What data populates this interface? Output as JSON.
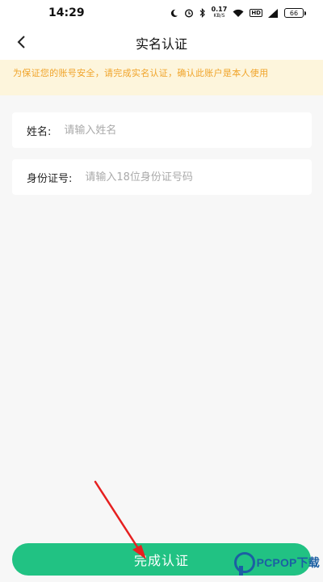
{
  "status_bar": {
    "time": "14:29",
    "speed_value": "0.17",
    "speed_unit": "KB/S",
    "hd_label": "HD",
    "battery": "66",
    "icons": [
      "moon-icon",
      "alarm-icon",
      "bluetooth-icon",
      "wifi-icon",
      "signal-icon"
    ]
  },
  "header": {
    "title": "实名认证",
    "back_icon": "chevron-left-icon"
  },
  "notice": {
    "text": "为保证您的账号安全，请完成实名认证，确认此账户是本人使用"
  },
  "form": {
    "name": {
      "label": "姓名:",
      "value": "",
      "placeholder": "请输入姓名"
    },
    "id_number": {
      "label": "身份证号:",
      "value": "",
      "placeholder": "请输入18位身份证号码"
    }
  },
  "submit": {
    "label": "完成认证"
  },
  "watermark": {
    "text": "PCPOP下载"
  },
  "colors": {
    "accent": "#21c283",
    "notice_bg": "#fdf5dc",
    "notice_text": "#f0a42a",
    "annotation": "#e62020"
  }
}
